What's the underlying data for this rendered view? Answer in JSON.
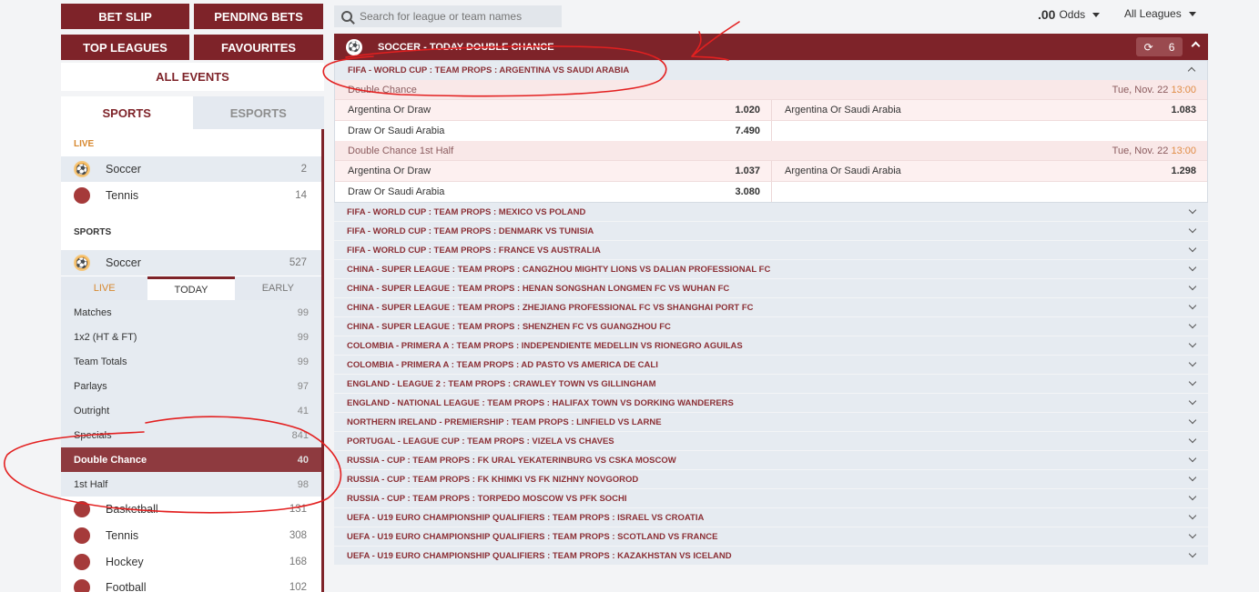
{
  "sidebar": {
    "bet_slip": "BET SLIP",
    "pending_bets": "PENDING BETS",
    "top_leagues": "TOP LEAGUES",
    "favourites": "FAVOURITES",
    "all_events": "ALL EVENTS",
    "tab_sports": "SPORTS",
    "tab_esports": "ESPORTS",
    "live_label": "LIVE",
    "live_sports": [
      {
        "name": "Soccer",
        "count": "2"
      },
      {
        "name": "Tennis",
        "count": "14"
      }
    ],
    "sports_label": "SPORTS",
    "soccer": {
      "name": "Soccer",
      "count": "527"
    },
    "subtabs": {
      "live": "LIVE",
      "today": "TODAY",
      "early": "EARLY"
    },
    "markets": [
      {
        "name": "Matches",
        "count": "99"
      },
      {
        "name": "1x2 (HT & FT)",
        "count": "99"
      },
      {
        "name": "Team Totals",
        "count": "99"
      },
      {
        "name": "Parlays",
        "count": "97"
      },
      {
        "name": "Outright",
        "count": "41"
      },
      {
        "name": "Specials",
        "count": "841"
      },
      {
        "name": "Double Chance",
        "count": "40"
      },
      {
        "name": "1st Half",
        "count": "98"
      }
    ],
    "other_sports": [
      {
        "name": "Basketball",
        "count": "131"
      },
      {
        "name": "Tennis",
        "count": "308"
      },
      {
        "name": "Hockey",
        "count": "168"
      },
      {
        "name": "Football",
        "count": "102"
      }
    ]
  },
  "search": {
    "placeholder": "Search for league or team names"
  },
  "odds_format": {
    "value": ".00",
    "label": "Odds"
  },
  "league_filter": "All Leagues",
  "main": {
    "header_title": "SOCCER - TODAY DOUBLE CHANCE",
    "refresh_count": "6",
    "open_event": {
      "title": "FIFA - WORLD CUP : TEAM PROPS : ARGENTINA VS SAUDI ARABIA",
      "markets": [
        {
          "name": "Double Chance",
          "date": "Tue, Nov. 22",
          "time": "13:00",
          "rows": [
            [
              {
                "label": "Argentina Or Draw",
                "odds": "1.020"
              },
              {
                "label": "Argentina Or Saudi Arabia",
                "odds": "1.083"
              }
            ],
            [
              {
                "label": "Draw Or Saudi Arabia",
                "odds": "7.490"
              }
            ]
          ]
        },
        {
          "name": "Double Chance 1st Half",
          "date": "Tue, Nov. 22",
          "time": "13:00",
          "rows": [
            [
              {
                "label": "Argentina Or Draw",
                "odds": "1.037"
              },
              {
                "label": "Argentina Or Saudi Arabia",
                "odds": "1.298"
              }
            ],
            [
              {
                "label": "Draw Or Saudi Arabia",
                "odds": "3.080"
              }
            ]
          ]
        }
      ]
    },
    "events": [
      "FIFA - WORLD CUP : TEAM PROPS : MEXICO VS POLAND",
      "FIFA - WORLD CUP : TEAM PROPS : DENMARK VS TUNISIA",
      "FIFA - WORLD CUP : TEAM PROPS : FRANCE VS AUSTRALIA",
      "CHINA - SUPER LEAGUE : TEAM PROPS : CANGZHOU MIGHTY LIONS VS DALIAN PROFESSIONAL FC",
      "CHINA - SUPER LEAGUE : TEAM PROPS : HENAN SONGSHAN LONGMEN FC VS WUHAN FC",
      "CHINA - SUPER LEAGUE : TEAM PROPS : ZHEJIANG PROFESSIONAL FC VS SHANGHAI PORT FC",
      "CHINA - SUPER LEAGUE : TEAM PROPS : SHENZHEN FC VS GUANGZHOU FC",
      "COLOMBIA - PRIMERA A : TEAM PROPS : INDEPENDIENTE MEDELLIN VS RIONEGRO AGUILAS",
      "COLOMBIA - PRIMERA A : TEAM PROPS : AD PASTO VS AMERICA DE CALI",
      "ENGLAND - LEAGUE 2 : TEAM PROPS : CRAWLEY TOWN VS GILLINGHAM",
      "ENGLAND - NATIONAL LEAGUE : TEAM PROPS : HALIFAX TOWN VS DORKING WANDERERS",
      "NORTHERN IRELAND - PREMIERSHIP : TEAM PROPS : LINFIELD VS LARNE",
      "PORTUGAL - LEAGUE CUP : TEAM PROPS : VIZELA VS CHAVES",
      "RUSSIA - CUP : TEAM PROPS : FK URAL YEKATERINBURG VS CSKA MOSCOW",
      "RUSSIA - CUP : TEAM PROPS : FK KHIMKI VS FK NIZHNY NOVGOROD",
      "RUSSIA - CUP : TEAM PROPS : TORPEDO MOSCOW VS PFK SOCHI",
      "UEFA - U19 EURO CHAMPIONSHIP QUALIFIERS : TEAM PROPS : ISRAEL VS CROATIA",
      "UEFA - U19 EURO CHAMPIONSHIP QUALIFIERS : TEAM PROPS : SCOTLAND VS FRANCE",
      "UEFA - U19 EURO CHAMPIONSHIP QUALIFIERS : TEAM PROPS : KAZAKHSTAN VS ICELAND"
    ]
  },
  "colors": {
    "brand": "#7e2329",
    "accent_orange": "#e08c45",
    "live_orange": "#d7882f"
  }
}
